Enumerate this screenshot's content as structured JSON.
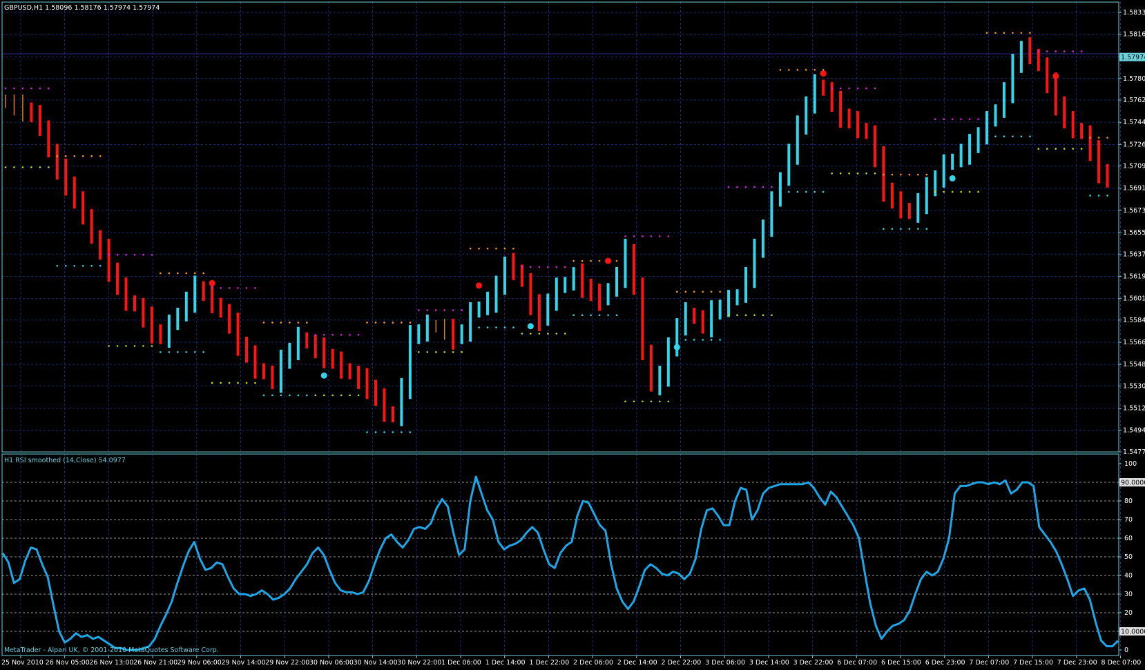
{
  "main_chart": {
    "header": "GBPUSD,H1  1.58096 1.58176 1.57974 1.57974",
    "price_axis_labels": [
      "1.58335",
      "1.58160",
      "1.57974",
      "1.57800",
      "1.57625",
      "1.57445",
      "1.57265",
      "1.57090",
      "1.56910",
      "1.56730",
      "1.56550",
      "1.56375",
      "1.56195",
      "1.56015",
      "1.55840",
      "1.55660",
      "1.55480",
      "1.55305",
      "1.55125",
      "1.54945",
      "1.54770"
    ],
    "current_price_label": "1.57974",
    "colors": {
      "bull": "#32d5ea",
      "bear": "#ff1414",
      "neutral": "#d2821e",
      "grid": "#1c2a7a",
      "frame": "#6dd3df",
      "price_line": "#2c2c8c"
    },
    "chart_data": {
      "type": "candlestick",
      "symbol": "GBPUSD",
      "timeframe": "H1",
      "ylim": [
        1.5477,
        1.5842
      ],
      "ohlc_close_series": [
        1.576,
        1.5757,
        1.5755,
        1.575,
        1.5742,
        1.572,
        1.5705,
        1.5695,
        1.568,
        1.567,
        1.565,
        1.564,
        1.5625,
        1.561,
        1.56,
        1.5595,
        1.5585,
        1.5575,
        1.557,
        1.558,
        1.559,
        1.56,
        1.561,
        1.5605,
        1.5598,
        1.559,
        1.558,
        1.5565,
        1.5555,
        1.5545,
        1.554,
        1.5535,
        1.555,
        1.556,
        1.557,
        1.5565,
        1.556,
        1.5555,
        1.555,
        1.5545,
        1.554,
        1.5535,
        1.553,
        1.552,
        1.551,
        1.5505,
        1.553,
        1.557,
        1.5575,
        1.558,
        1.5578,
        1.5575,
        1.557,
        1.5575,
        1.559,
        1.5595,
        1.56,
        1.561,
        1.563,
        1.5625,
        1.5615,
        1.5595,
        1.5585,
        1.56,
        1.561,
        1.5615,
        1.562,
        1.5612,
        1.5605,
        1.56,
        1.561,
        1.562,
        1.564,
        1.561,
        1.556,
        1.553,
        1.554,
        1.556,
        1.558,
        1.559,
        1.5585,
        1.558,
        1.559,
        1.5595,
        1.56,
        1.5605,
        1.562,
        1.564,
        1.566,
        1.568,
        1.57,
        1.572,
        1.574,
        1.576,
        1.5775,
        1.577,
        1.576,
        1.575,
        1.5745,
        1.574,
        1.5735,
        1.5715,
        1.569,
        1.568,
        1.5675,
        1.567,
        1.568,
        1.569,
        1.57,
        1.571,
        1.5715,
        1.572,
        1.5725,
        1.5735,
        1.5745,
        1.5755,
        1.577,
        1.579,
        1.5805,
        1.58,
        1.579,
        1.5775,
        1.576,
        1.5745,
        1.574,
        1.5735,
        1.572,
        1.5705,
        1.5697
      ]
    },
    "sar_markers": {
      "red_note": "resistance dots",
      "cyan_note": "support dots"
    }
  },
  "rsi_panel": {
    "header": "H1 RSI smoothed (14,Close) 54.0977",
    "scale_labels": [
      "100",
      "90.0000",
      "80",
      "70",
      "60",
      "50",
      "40",
      "30",
      "20",
      "10.0000",
      "0"
    ],
    "chart_data": {
      "type": "line",
      "ylim": [
        0,
        100
      ],
      "levels": [
        10,
        90
      ],
      "values": [
        52,
        47,
        36,
        38,
        48,
        55,
        54,
        46,
        39,
        24,
        10,
        4,
        6,
        9,
        7,
        8,
        6,
        7,
        5,
        3,
        1,
        1,
        0,
        0,
        0,
        1,
        2,
        6,
        13,
        19,
        26,
        36,
        45,
        53,
        58,
        49,
        43,
        44,
        47,
        46,
        39,
        33,
        30,
        30,
        29,
        30,
        32,
        30,
        27,
        28,
        30,
        33,
        38,
        42,
        46,
        52,
        55,
        51,
        43,
        36,
        32,
        31,
        31,
        30,
        31,
        37,
        46,
        54,
        60,
        62,
        58,
        55,
        59,
        65,
        66,
        65,
        68,
        76,
        81,
        77,
        63,
        51,
        54,
        80,
        93,
        84,
        75,
        70,
        58,
        54,
        56,
        57,
        59,
        63,
        66,
        63,
        54,
        46,
        44,
        52,
        56,
        58,
        72,
        80,
        79,
        73,
        67,
        64,
        46,
        33,
        26,
        22,
        26,
        34,
        43,
        46,
        44,
        41,
        40,
        42,
        41,
        38,
        41,
        49,
        65,
        75,
        76,
        72,
        67,
        67,
        80,
        87,
        86,
        70,
        75,
        84,
        87,
        88,
        89,
        89,
        89,
        89,
        89,
        90,
        87,
        82,
        78,
        85,
        82,
        77,
        72,
        67,
        60,
        42,
        25,
        13,
        6,
        10,
        13,
        14,
        16,
        21,
        30,
        38,
        42,
        40,
        42,
        49,
        60,
        84,
        88,
        88,
        89,
        90,
        90,
        89,
        90,
        89,
        91,
        84,
        86,
        90,
        90,
        88,
        66,
        62,
        58,
        53,
        46,
        38,
        29,
        32,
        33,
        27,
        15,
        5,
        2,
        2,
        5
      ]
    }
  },
  "time_axis_labels": [
    "25 Nov 2010",
    "26 Nov 05:00",
    "26 Nov 13:00",
    "26 Nov 21:00",
    "29 Nov 06:00",
    "29 Nov 14:00",
    "29 Nov 22:00",
    "30 Nov 06:00",
    "30 Nov 14:00",
    "30 Nov 22:00",
    "1 Dec 06:00",
    "1 Dec 14:00",
    "1 Dec 22:00",
    "2 Dec 06:00",
    "2 Dec 14:00",
    "2 Dec 22:00",
    "3 Dec 06:00",
    "3 Dec 14:00",
    "3 Dec 22:00",
    "6 Dec 07:00",
    "6 Dec 15:00",
    "6 Dec 23:00",
    "7 Dec 07:00",
    "7 Dec 15:00",
    "7 Dec 23:00",
    "8 Dec 07:00"
  ],
  "watermark": "MetaTrader - Alpari UK, © 2001-2010 MetaQuotes Software Corp."
}
